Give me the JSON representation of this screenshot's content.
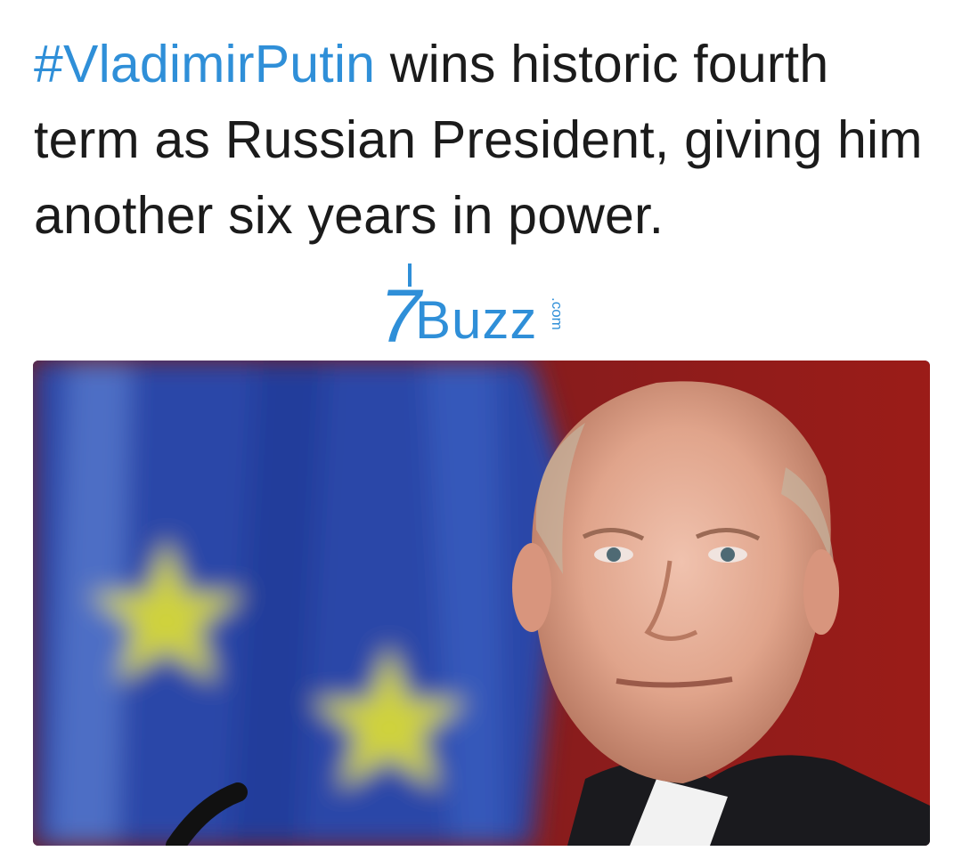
{
  "tweet": {
    "hashtag": "#VladimirPutin",
    "text": " wins historic fourth term as Russian President, giving him another six years in power."
  },
  "watermark": {
    "brand_mark": "7",
    "brand_text": "Buzz",
    "brand_suffix": ".com"
  },
  "media": {
    "icon": "news-photo",
    "colors": {
      "flag_blue": "#2a46a8",
      "flag_star": "#d9d63a",
      "backdrop_red": "#8d1b18"
    }
  }
}
